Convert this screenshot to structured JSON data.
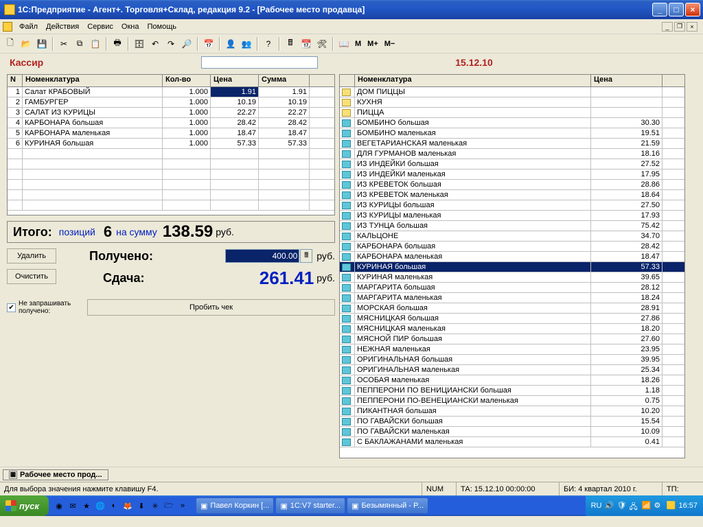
{
  "title": "1C:Предприятие - Агент+. Торговля+Склад, редакция 9.2 - [Рабочее место продавца]",
  "menus": [
    "Файл",
    "Действия",
    "Сервис",
    "Окна",
    "Помощь"
  ],
  "header": {
    "kassir": "Кассир",
    "date": "15.12.10"
  },
  "cart": {
    "headers": {
      "n": "N",
      "nom": "Номенклатура",
      "qty": "Кол-во",
      "price": "Цена",
      "sum": "Сумма"
    },
    "rows": [
      {
        "n": "1",
        "nom": "Салат КРАБОВЫЙ",
        "qty": "1.000",
        "price": "1.91",
        "sum": "1.91",
        "sel_price": true
      },
      {
        "n": "2",
        "nom": "ГАМБУРГЕР",
        "qty": "1.000",
        "price": "10.19",
        "sum": "10.19"
      },
      {
        "n": "3",
        "nom": "САЛАТ ИЗ КУРИЦЫ",
        "qty": "1.000",
        "price": "22.27",
        "sum": "22.27"
      },
      {
        "n": "4",
        "nom": "КАРБОНАРА большая",
        "qty": "1.000",
        "price": "28.42",
        "sum": "28.42"
      },
      {
        "n": "5",
        "nom": "КАРБОНАРА маленькая",
        "qty": "1.000",
        "price": "18.47",
        "sum": "18.47"
      },
      {
        "n": "6",
        "nom": "КУРИНАЯ большая",
        "qty": "1.000",
        "price": "57.33",
        "sum": "57.33"
      }
    ]
  },
  "totals": {
    "itogo": "Итого:",
    "positions_lbl": "позиций",
    "positions": "6",
    "sum_lbl": "на сумму",
    "sum": "138.59",
    "rub": "руб.",
    "received_lbl": "Получено:",
    "received_val": "400.00",
    "change_lbl": "Сдача:",
    "change_val": "261.41",
    "btn_del": "Удалить",
    "btn_clear": "Очистить",
    "chk_lbl": "Не запрашивать получено:",
    "chk_checked": true,
    "btn_probit": "Пробить чек"
  },
  "catalog": {
    "headers": {
      "nom": "Номенклатура",
      "price": "Цена"
    },
    "rows": [
      {
        "nom": "ДОМ ПИЦЦЫ",
        "price": "",
        "folder": "yellow"
      },
      {
        "nom": "КУХНЯ",
        "price": "",
        "folder": "yellow"
      },
      {
        "nom": "ПИЦЦА",
        "price": "",
        "folder": "yellow"
      },
      {
        "nom": "БОМБИНО большая",
        "price": "30.30"
      },
      {
        "nom": "БОМБИНО маленькая",
        "price": "19.51"
      },
      {
        "nom": "ВЕГЕТАРИАНСКАЯ маленькая",
        "price": "21.59"
      },
      {
        "nom": "ДЛЯ ГУРМАНОВ маленькая",
        "price": "18.16"
      },
      {
        "nom": "ИЗ ИНДЕЙКИ большая",
        "price": "27.52"
      },
      {
        "nom": "ИЗ ИНДЕЙКИ маленькая",
        "price": "17.95"
      },
      {
        "nom": "ИЗ КРЕВЕТОК большая",
        "price": "28.86"
      },
      {
        "nom": "ИЗ КРЕВЕТОК маленькая",
        "price": "18.64"
      },
      {
        "nom": "ИЗ КУРИЦЫ большая",
        "price": "27.50"
      },
      {
        "nom": "ИЗ КУРИЦЫ маленькая",
        "price": "17.93"
      },
      {
        "nom": "ИЗ ТУНЦА большая",
        "price": "75.42"
      },
      {
        "nom": "КАЛЬЦОНЕ",
        "price": "34.70"
      },
      {
        "nom": "КАРБОНАРА большая",
        "price": "28.42"
      },
      {
        "nom": "КАРБОНАРА маленькая",
        "price": "18.47"
      },
      {
        "nom": "КУРИНАЯ большая",
        "price": "57.33",
        "selected": true
      },
      {
        "nom": "КУРИНАЯ маленькая",
        "price": "39.65"
      },
      {
        "nom": "МАРГАРИТА большая",
        "price": "28.12"
      },
      {
        "nom": "МАРГАРИТА маленькая",
        "price": "18.24"
      },
      {
        "nom": "МОРСКАЯ большая",
        "price": "28.91"
      },
      {
        "nom": "МЯСНИЦКАЯ большая",
        "price": "27.86"
      },
      {
        "nom": "МЯСНИЦКАЯ маленькая",
        "price": "18.20"
      },
      {
        "nom": "МЯСНОЙ ПИР большая",
        "price": "27.60"
      },
      {
        "nom": "НЕЖНАЯ маленькая",
        "price": "23.95"
      },
      {
        "nom": "ОРИГИНАЛЬНАЯ большая",
        "price": "39.95"
      },
      {
        "nom": "ОРИГИНАЛЬНАЯ маленькая",
        "price": "25.34"
      },
      {
        "nom": "ОСОБАЯ маленькая",
        "price": "18.26"
      },
      {
        "nom": "ПЕППЕРОНИ ПО ВЕНИЦИАНСКИ большая",
        "price": "1.18"
      },
      {
        "nom": "ПЕППЕРОНИ ПО-ВЕНЕЦИАНСКИ маленькая",
        "price": "0.75"
      },
      {
        "nom": "ПИКАНТНАЯ большая",
        "price": "10.20"
      },
      {
        "nom": "ПО ГАВАЙСКИ большая",
        "price": "15.54"
      },
      {
        "nom": "ПО ГАВАЙСКИ маленькая",
        "price": "10.09"
      },
      {
        "nom": "С БАКЛАЖАНАМИ маленькая",
        "price": "0.41"
      }
    ]
  },
  "doc_tab": "Рабочее место прод...",
  "status": {
    "hint": "Для выбора значения нажмите клавишу F4.",
    "num": "NUM",
    "ta": "ТА: 15.12.10  00:00:00",
    "bi": "БИ: 4 квартал 2010 г.",
    "tp": "ТП:"
  },
  "taskbar": {
    "start": "пуск",
    "tasks": [
      {
        "label": "Павел Коркин [..."
      },
      {
        "label": "1C:V7 starter...",
        "active": false
      },
      {
        "label": "Безымянный - P..."
      }
    ],
    "lang": "RU",
    "clock": "16:57"
  }
}
